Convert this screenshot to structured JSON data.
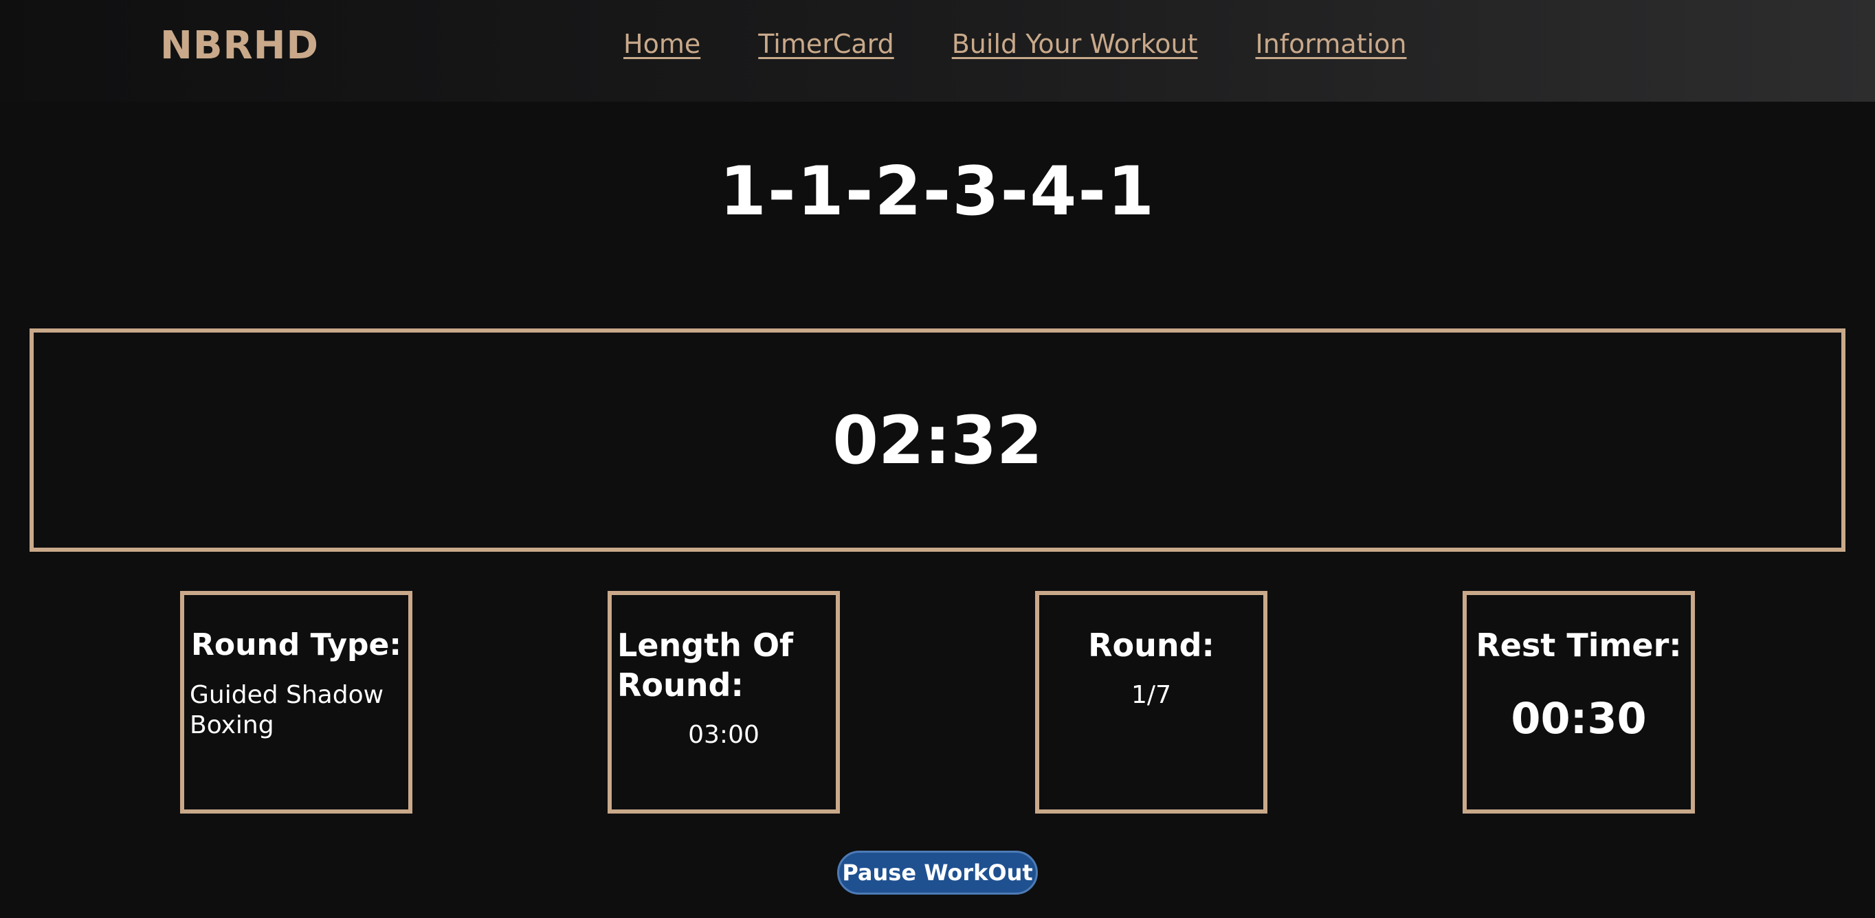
{
  "brand": "NBRHD",
  "nav": {
    "items": [
      {
        "label": "Home"
      },
      {
        "label": "TimerCard"
      },
      {
        "label": "Build Your Workout"
      },
      {
        "label": "Information"
      }
    ]
  },
  "workout": {
    "title": "1-1-2-3-4-1",
    "timer": "02:32"
  },
  "cards": {
    "round_type": {
      "label": "Round Type:",
      "value": "Guided Shadow Boxing"
    },
    "length_of_round": {
      "label": "Length Of Round:",
      "value": "03:00"
    },
    "round": {
      "label": "Round:",
      "value": "1/7"
    },
    "rest_timer": {
      "label": "Rest Timer:",
      "value": "00:30"
    }
  },
  "controls": {
    "pause_label": "Pause WorkOut"
  },
  "colors": {
    "accent": "#c9a98a",
    "background": "#0e0e0f",
    "button": "#1f5191"
  }
}
